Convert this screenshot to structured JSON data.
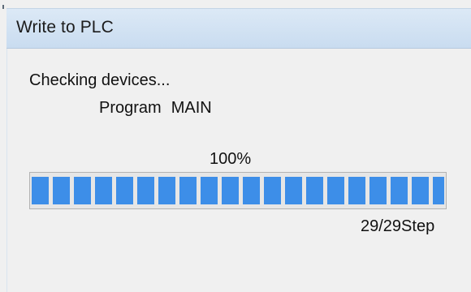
{
  "window": {
    "title": "Write to PLC"
  },
  "status": {
    "message": "Checking devices...",
    "program_label": "Program",
    "program_name": "MAIN"
  },
  "progress": {
    "percent_text": "100%",
    "fraction": 1.0,
    "bar_color": "#3d8ee8",
    "step_text": "29/29Step"
  }
}
